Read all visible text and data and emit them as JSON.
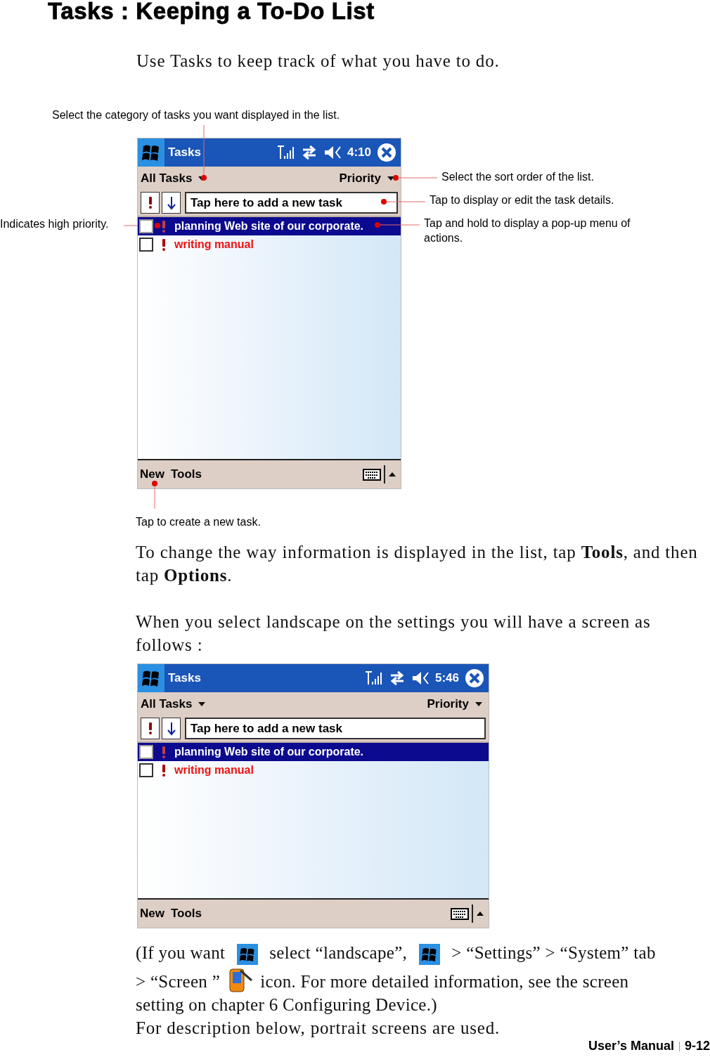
{
  "page_title": "Tasks : Keeping a To-Do List",
  "intro": "Use Tasks to keep track of what you have to do.",
  "callouts": [
    {
      "text": "Select the category of tasks you want displayed in the list."
    },
    {
      "text": "Select the sort order of the list."
    },
    {
      "text": "Tap to display or edit the task details."
    },
    {
      "text": "Indicates high priority."
    },
    {
      "text": "Tap and hold to display a pop-up menu of actions."
    },
    {
      "text": "Tap to create a new task."
    }
  ],
  "screens": [
    {
      "title": "Tasks",
      "time": "4:10",
      "category": "All Tasks",
      "sort": "Priority",
      "new_task": {
        "placeholder": "Tap here to add a new task"
      },
      "tasks": [
        {
          "text": "planning Web site of our corporate.",
          "selected": true,
          "high_priority": true,
          "checked": false
        },
        {
          "text": "writing manual",
          "selected": false,
          "high_priority": true,
          "checked": false,
          "overdue": true
        }
      ],
      "menu": [
        "New",
        "Tools"
      ]
    },
    {
      "title": "Tasks",
      "time": "5:46",
      "category": "All Tasks",
      "sort": "Priority",
      "new_task": {
        "placeholder": "Tap here to add a new task"
      },
      "tasks": [
        {
          "text": "planning Web site of our corporate.",
          "selected": true,
          "high_priority": true,
          "checked": false
        },
        {
          "text": "writing manual",
          "selected": false,
          "high_priority": true,
          "checked": false,
          "overdue": true
        }
      ],
      "menu": [
        "New",
        "Tools"
      ]
    }
  ],
  "paragraphs": [
    "To change the way information is displayed in the list, tap **Tools**, and then tap **Options**.",
    "When you select landscape on the settings you will have a screen as follows :"
  ],
  "landscape_note": [
    [
      {
        "kind": "text",
        "text": "(If you want"
      },
      {
        "kind": "start_icon"
      },
      {
        "kind": "text",
        "text": "select “landscape”,"
      },
      {
        "kind": "start_icon"
      },
      {
        "kind": "text",
        "text": "> “Settings” > “System” tab"
      }
    ],
    [
      {
        "kind": "text",
        "text": "> “Screen ”"
      },
      {
        "kind": "screen_icon"
      },
      {
        "kind": "text",
        "text": "icon. For more detailed information, see the screen"
      }
    ],
    [
      {
        "kind": "text",
        "text": "setting on chapter 6 Configuring Device.)"
      }
    ]
  ],
  "closing": "For description below, portrait screens are used.",
  "footer": {
    "manual": "User’s Manual",
    "page": "9-12"
  }
}
